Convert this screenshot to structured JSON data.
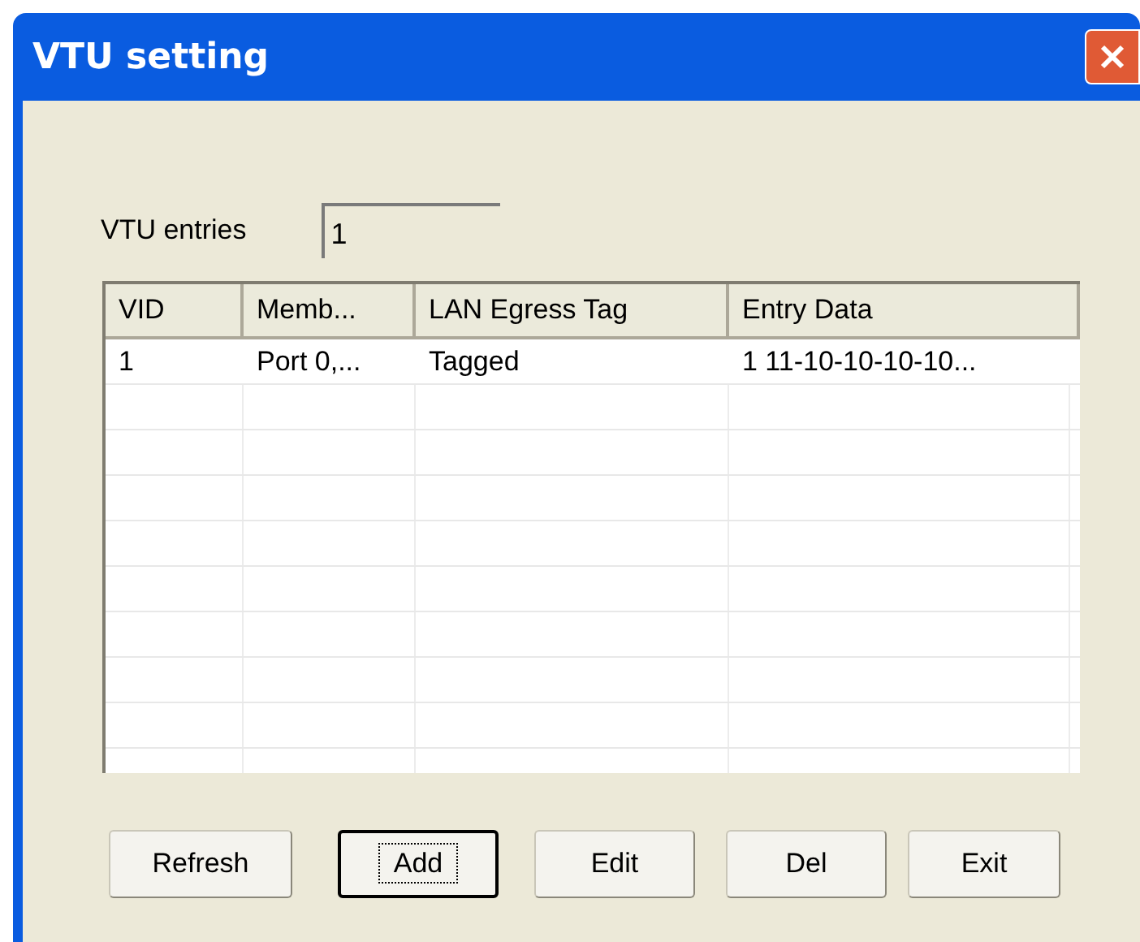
{
  "window": {
    "title": "VTU setting"
  },
  "entries": {
    "label": "VTU entries",
    "value": "1"
  },
  "table": {
    "columns": [
      "VID",
      "Memb...",
      "LAN Egress Tag",
      "Entry Data"
    ],
    "rows": [
      [
        "1",
        "Port 0,...",
        "Tagged",
        "1 11-10-10-10-10..."
      ]
    ]
  },
  "buttons": [
    {
      "label": "Refresh",
      "focused": false
    },
    {
      "label": "Add",
      "focused": true
    },
    {
      "label": "Edit",
      "focused": false
    },
    {
      "label": "Del",
      "focused": false
    },
    {
      "label": "Exit",
      "focused": false
    }
  ]
}
